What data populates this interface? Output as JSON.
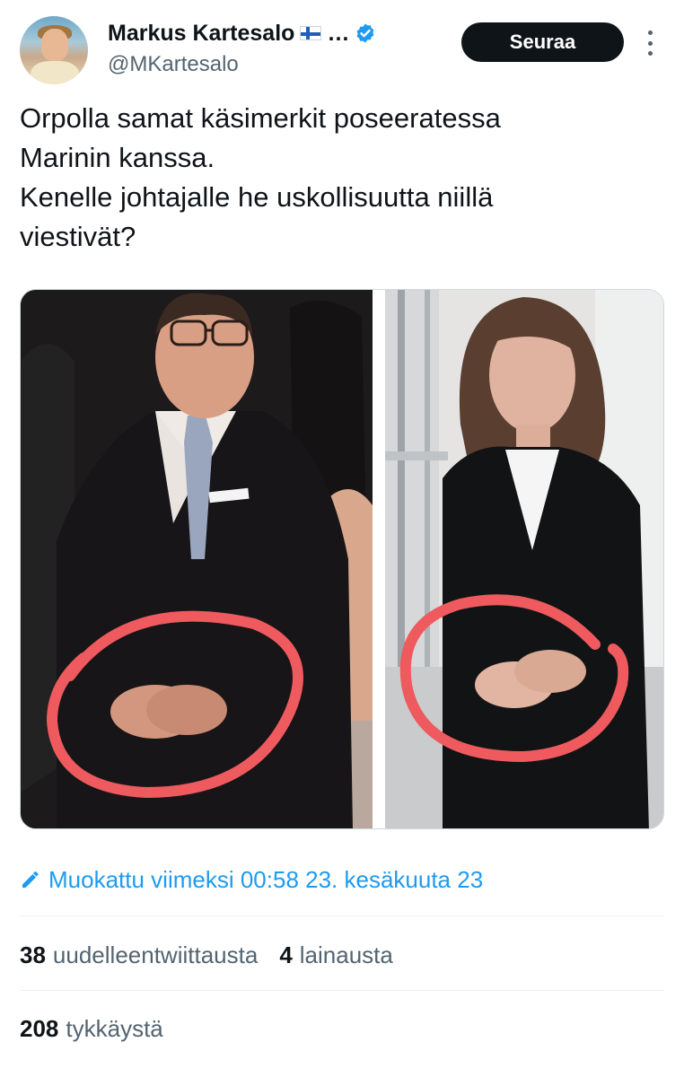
{
  "author": {
    "name": "Markus Kartesalo",
    "ellipsis": "…",
    "handle": "@MKartesalo",
    "flag_icon": "finland-flag-icon",
    "verified_icon": "verified-badge-icon"
  },
  "follow_button": {
    "label": "Seuraa"
  },
  "tweet": {
    "lines": [
      "Orpolla samat käsimerkit poseeratessa",
      "Marinin kanssa.",
      "Kenelle johtajalle he uskollisuutta niillä",
      "viestivät?"
    ]
  },
  "media": {
    "description_icon": "photo-collage"
  },
  "edited": {
    "icon": "pencil-icon",
    "text": "Muokattu viimeksi 00:58 23. kesäkuuta 23"
  },
  "stats": {
    "retweets_count": "38",
    "retweets_label": "uudelleentwiittausta",
    "quotes_count": "4",
    "quotes_label": "lainausta",
    "likes_count": "208",
    "likes_label": "tykkäystä"
  },
  "colors": {
    "accent": "#1d9bf0",
    "follow_bg": "#0f1419",
    "circle": "#ee5a5e"
  }
}
